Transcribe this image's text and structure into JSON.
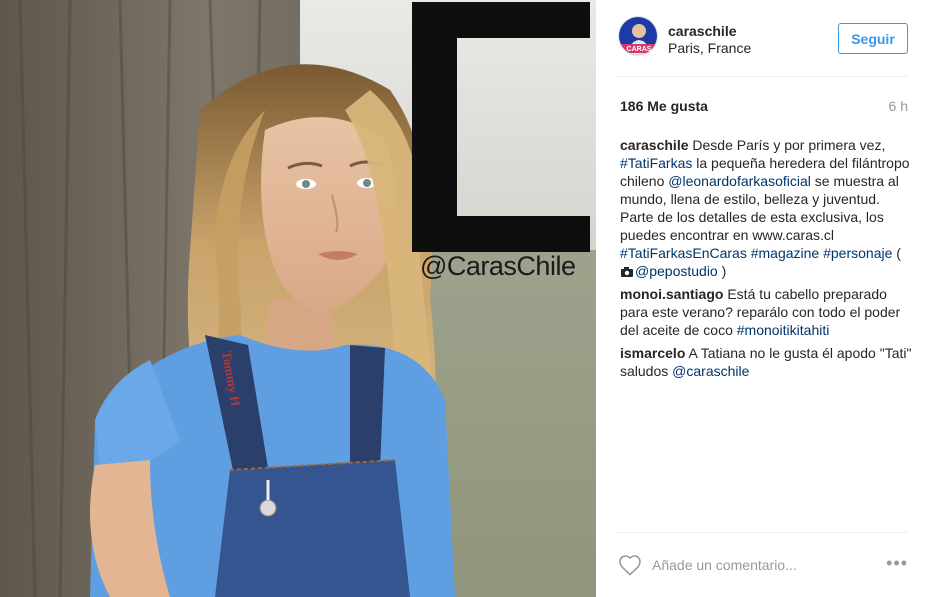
{
  "post": {
    "image_alt": "",
    "overlay_letter": "C",
    "overlay_handle": "@CarasChile",
    "strap_text": "Tommy H"
  },
  "header": {
    "username": "caraschile",
    "location": "Paris, France",
    "follow_label": "Seguir"
  },
  "stats": {
    "likes": "186 Me gusta",
    "time": "6 h"
  },
  "comments": [
    {
      "author": "caraschile",
      "parts": [
        " Desde París y por primera vez, ",
        "#TatiFarkas",
        " la pequeña heredera del filántropo chileno ",
        "@leonardofarkasoficial",
        " se muestra al mundo, llena de estilo, belleza y juventud. Parte de los detalles de esta exclusiva, los puedes encontrar en www.caras.cl ",
        "#TatiFarkasEnCaras",
        " ",
        "#magazine",
        " ",
        "#personaje",
        " (",
        "@pepostudio",
        " )"
      ]
    },
    {
      "author": "monoi.santiago",
      "parts": [
        " Está tu cabello preparado para este verano? reparálo con todo el poder del aceite de coco ",
        "#monoitikitahiti"
      ]
    },
    {
      "author": "ismarcelo",
      "parts": [
        " A Tatiana no le gusta él apodo \"Tati\" saludos ",
        "@caraschile"
      ]
    }
  ],
  "add_comment": {
    "placeholder": "Añade un comentario..."
  },
  "icons": {
    "like": "heart-icon",
    "more": "more-options-icon",
    "camera": "camera-icon"
  },
  "colors": {
    "link": "#003569",
    "follow": "#3897f0",
    "muted": "#999999"
  }
}
